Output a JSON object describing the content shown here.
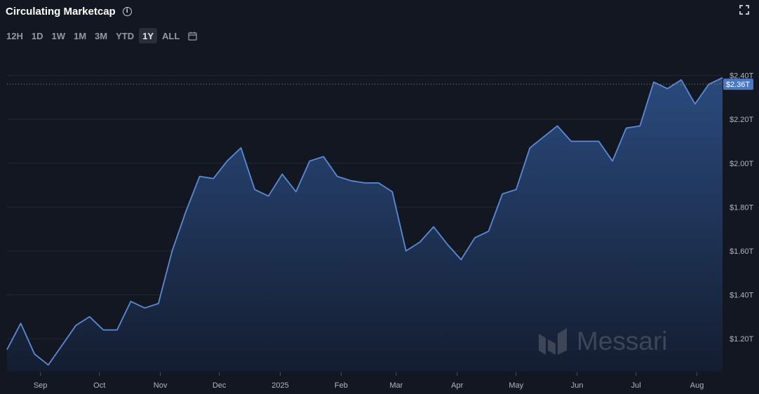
{
  "header": {
    "title": "Circulating Marketcap",
    "info_icon": "info-icon",
    "fullscreen_icon": "fullscreen-icon"
  },
  "range_tabs": [
    {
      "label": "12H",
      "active": false
    },
    {
      "label": "1D",
      "active": false
    },
    {
      "label": "1W",
      "active": false
    },
    {
      "label": "1M",
      "active": false
    },
    {
      "label": "3M",
      "active": false
    },
    {
      "label": "YTD",
      "active": false
    },
    {
      "label": "1Y",
      "active": true
    },
    {
      "label": "ALL",
      "active": false
    }
  ],
  "calendar_icon": "calendar-icon",
  "watermark": {
    "text": "Messari",
    "icon": "messari-logo-icon"
  },
  "colors": {
    "background": "#131722",
    "line": "#5b8ad6",
    "fill_top": "#2a4a7d",
    "fill_bottom": "#141d30",
    "grid": "#232838",
    "last_price_badge": "#4a78c2"
  },
  "chart_data": {
    "type": "area",
    "title": "Circulating Marketcap",
    "unit": "USD",
    "ylim": [
      1.05,
      2.45
    ],
    "yticks": [
      1.2,
      1.4,
      1.6,
      1.8,
      2.0,
      2.2,
      2.4
    ],
    "ytick_labels": [
      "$1.20T",
      "$1.40T",
      "$1.60T",
      "$1.80T",
      "$2.00T",
      "$2.20T",
      "$2.40T"
    ],
    "xlim": [
      "2024-08-15",
      "2025-08-14"
    ],
    "xticks": [
      "2024-09-01",
      "2024-10-01",
      "2024-11-01",
      "2024-12-01",
      "2025-01-01",
      "2025-02-01",
      "2025-03-01",
      "2025-04-01",
      "2025-05-01",
      "2025-06-01",
      "2025-07-01",
      "2025-08-01"
    ],
    "xtick_labels": [
      "Sep",
      "Oct",
      "Nov",
      "Dec",
      "2025",
      "Feb",
      "Mar",
      "Apr",
      "May",
      "Jun",
      "Jul",
      "Aug"
    ],
    "grid": true,
    "last_value": 2.36,
    "last_value_label": "$2.36T",
    "series": [
      {
        "values": [
          [
            "2024-08-15",
            1.15
          ],
          [
            "2024-08-22",
            1.27
          ],
          [
            "2024-08-29",
            1.13
          ],
          [
            "2024-09-05",
            1.08
          ],
          [
            "2024-09-12",
            1.17
          ],
          [
            "2024-09-19",
            1.26
          ],
          [
            "2024-09-26",
            1.3
          ],
          [
            "2024-10-03",
            1.24
          ],
          [
            "2024-10-10",
            1.24
          ],
          [
            "2024-10-17",
            1.37
          ],
          [
            "2024-10-24",
            1.34
          ],
          [
            "2024-10-31",
            1.36
          ],
          [
            "2024-11-07",
            1.6
          ],
          [
            "2024-11-14",
            1.78
          ],
          [
            "2024-11-21",
            1.94
          ],
          [
            "2024-11-28",
            1.93
          ],
          [
            "2024-12-05",
            2.01
          ],
          [
            "2024-12-12",
            2.07
          ],
          [
            "2024-12-19",
            1.88
          ],
          [
            "2024-12-26",
            1.85
          ],
          [
            "2025-01-02",
            1.95
          ],
          [
            "2025-01-09",
            1.87
          ],
          [
            "2025-01-16",
            2.01
          ],
          [
            "2025-01-23",
            2.03
          ],
          [
            "2025-01-30",
            1.94
          ],
          [
            "2025-02-06",
            1.92
          ],
          [
            "2025-02-13",
            1.91
          ],
          [
            "2025-02-20",
            1.91
          ],
          [
            "2025-02-27",
            1.87
          ],
          [
            "2025-03-06",
            1.6
          ],
          [
            "2025-03-13",
            1.64
          ],
          [
            "2025-03-20",
            1.71
          ],
          [
            "2025-03-27",
            1.63
          ],
          [
            "2025-04-03",
            1.56
          ],
          [
            "2025-04-10",
            1.66
          ],
          [
            "2025-04-17",
            1.69
          ],
          [
            "2025-04-24",
            1.86
          ],
          [
            "2025-05-01",
            1.88
          ],
          [
            "2025-05-08",
            2.07
          ],
          [
            "2025-05-15",
            2.12
          ],
          [
            "2025-05-22",
            2.17
          ],
          [
            "2025-05-29",
            2.1
          ],
          [
            "2025-06-05",
            2.1
          ],
          [
            "2025-06-12",
            2.1
          ],
          [
            "2025-06-19",
            2.01
          ],
          [
            "2025-06-26",
            2.16
          ],
          [
            "2025-07-03",
            2.17
          ],
          [
            "2025-07-10",
            2.37
          ],
          [
            "2025-07-17",
            2.34
          ],
          [
            "2025-07-24",
            2.38
          ],
          [
            "2025-07-31",
            2.27
          ],
          [
            "2025-08-07",
            2.36
          ],
          [
            "2025-08-14",
            2.39
          ]
        ]
      }
    ]
  }
}
